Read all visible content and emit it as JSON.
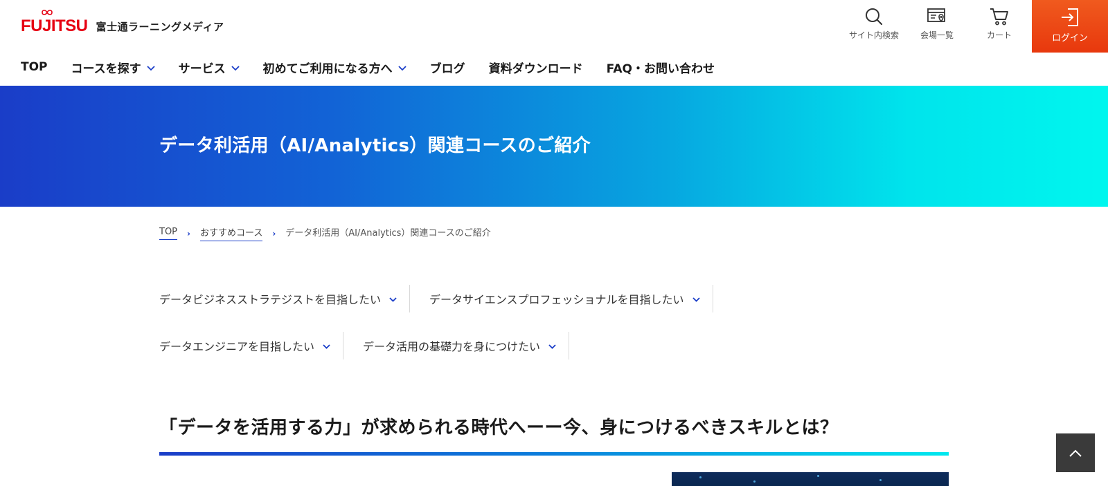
{
  "header": {
    "logo_text": "FUJITSU",
    "logo_sub": "富士通ラーニングメディア",
    "utility": [
      {
        "label": "サイト内検索",
        "icon": "search-icon"
      },
      {
        "label": "会場一覧",
        "icon": "venue-map-icon"
      },
      {
        "label": "カート",
        "icon": "cart-icon"
      }
    ],
    "login_label": "ログイン",
    "login_icon": "login-icon"
  },
  "nav": [
    {
      "label": "TOP",
      "has_dropdown": false
    },
    {
      "label": "コースを探す",
      "has_dropdown": true
    },
    {
      "label": "サービス",
      "has_dropdown": true
    },
    {
      "label": "初めてご利用になる方へ",
      "has_dropdown": true
    },
    {
      "label": "ブログ",
      "has_dropdown": false
    },
    {
      "label": "資料ダウンロード",
      "has_dropdown": false
    },
    {
      "label": "FAQ・お問い合わせ",
      "has_dropdown": false
    }
  ],
  "hero": {
    "title": "データ利活用（AI/Analytics）関連コースのご紹介"
  },
  "breadcrumb": {
    "items": [
      "TOP",
      "おすすめコース"
    ],
    "current": "データ利活用（AI/Analytics）関連コースのご紹介"
  },
  "anchors": [
    "データビジネスストラテジストを目指したい",
    "データサイエンスプロフェッショナルを目指したい",
    "データエンジニアを目指したい",
    "データ活用の基礎力を身につけたい"
  ],
  "section": {
    "title": "「データを活用する力」が求められる時代へーー今、身につけるべきスキルとは？"
  },
  "colors": {
    "brand_red": "#e60012",
    "login_orange": "#e8380d",
    "accent_blue": "#1a3dc8",
    "accent_cyan": "#00f0ee"
  }
}
